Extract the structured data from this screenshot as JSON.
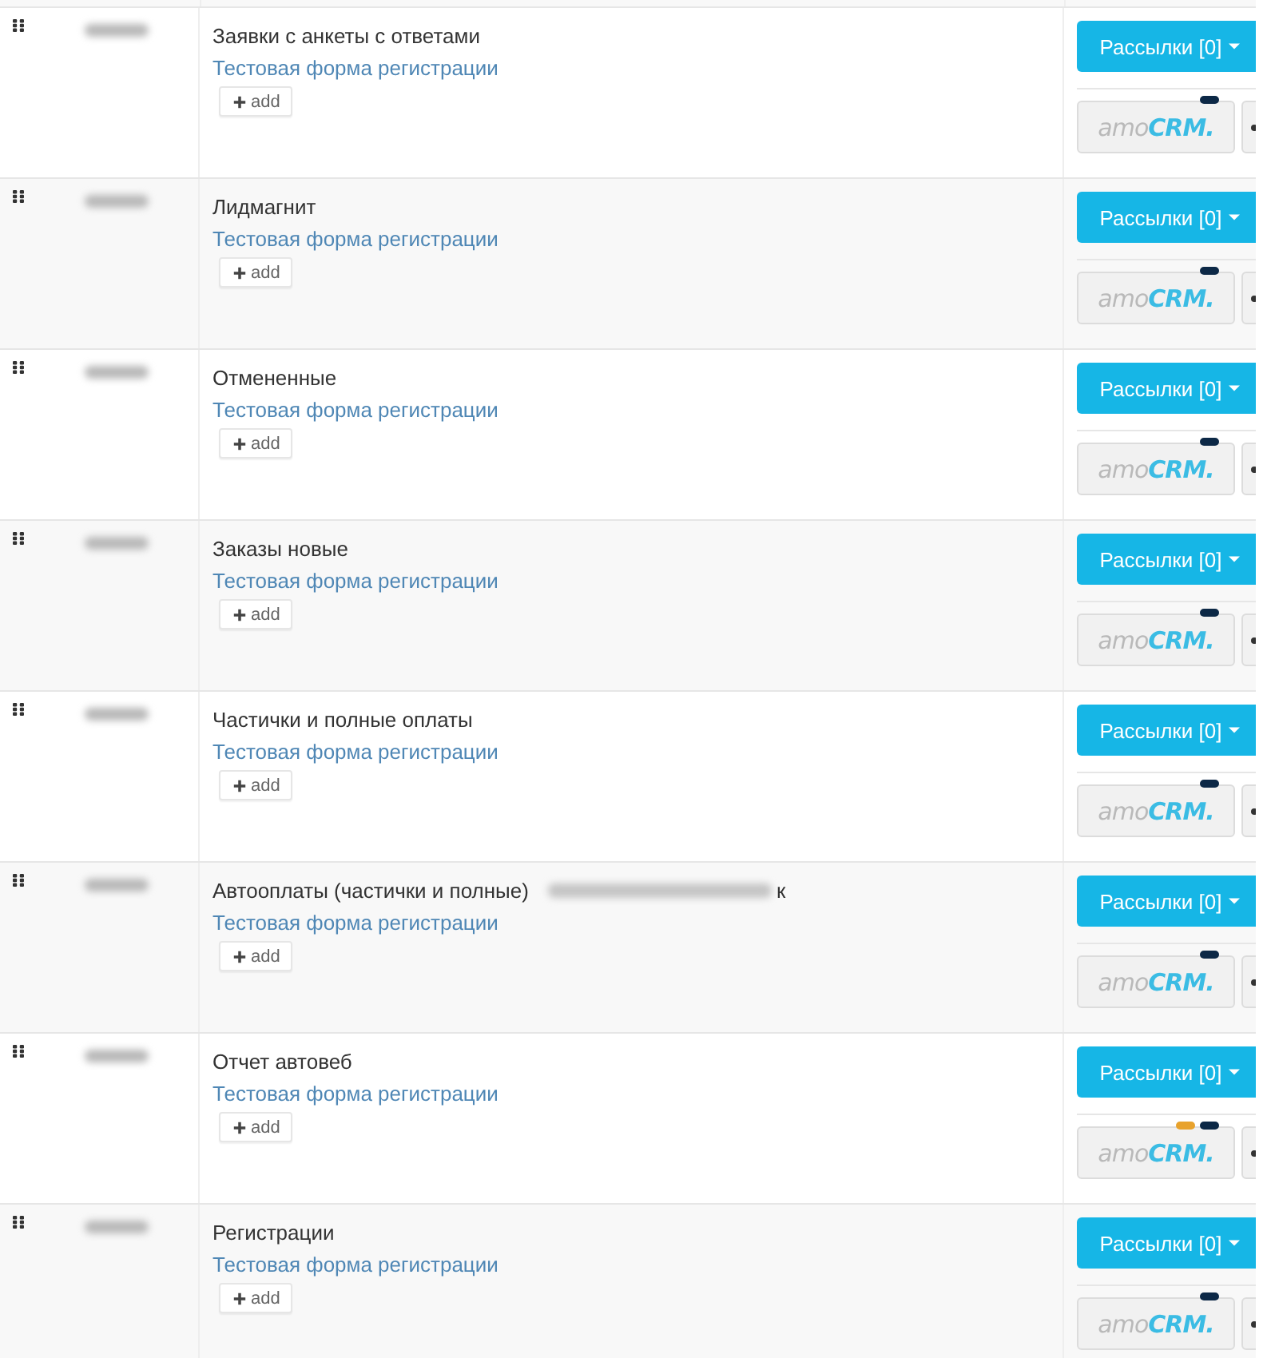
{
  "rows": [
    {
      "name": "Заявки с анкеты с ответами",
      "name_blurred": false,
      "form_link": "Тестовая форма регистрации",
      "add_label": "add",
      "mailings_label": "Рассылки [0]",
      "logo_prefix": "amo",
      "logo_suffix": "CRM.",
      "badges": [
        {
          "color": "#0c2846"
        }
      ]
    },
    {
      "name": "Лидмагнит",
      "name_blurred": false,
      "form_link": "Тестовая форма регистрации",
      "add_label": "add",
      "mailings_label": "Рассылки [0]",
      "logo_prefix": "amo",
      "logo_suffix": "CRM.",
      "badges": [
        {
          "color": "#0c2846"
        }
      ]
    },
    {
      "name": "Отмененные",
      "name_blurred": false,
      "form_link": "Тестовая форма регистрации",
      "add_label": "add",
      "mailings_label": "Рассылки [0]",
      "logo_prefix": "amo",
      "logo_suffix": "CRM.",
      "badges": [
        {
          "color": "#0c2846"
        }
      ]
    },
    {
      "name": "Заказы новые",
      "name_blurred": false,
      "form_link": "Тестовая форма регистрации",
      "add_label": "add",
      "mailings_label": "Рассылки [0]",
      "logo_prefix": "amo",
      "logo_suffix": "CRM.",
      "badges": [
        {
          "color": "#0c2846"
        }
      ]
    },
    {
      "name": "Частички и полные оплаты",
      "name_blurred": false,
      "form_link": "Тестовая форма регистрации",
      "add_label": "add",
      "mailings_label": "Рассылки [0]",
      "logo_prefix": "amo",
      "logo_suffix": "CRM.",
      "badges": [
        {
          "color": "#0c2846"
        }
      ]
    },
    {
      "name": "Автооплаты (частички и полные)",
      "name_blurred": true,
      "name_tail": "к",
      "form_link": "Тестовая форма регистрации",
      "add_label": "add",
      "mailings_label": "Рассылки [0]",
      "logo_prefix": "amo",
      "logo_suffix": "CRM.",
      "badges": [
        {
          "color": "#0c2846"
        }
      ]
    },
    {
      "name": "Отчет автовеб",
      "name_blurred": false,
      "form_link": "Тестовая форма регистрации",
      "add_label": "add",
      "mailings_label": "Рассылки [0]",
      "logo_prefix": "amo",
      "logo_suffix": "CRM.",
      "badges": [
        {
          "color": "#e8a22c"
        },
        {
          "color": "#0c2846"
        }
      ]
    },
    {
      "name": "Регистрации",
      "name_blurred": false,
      "form_link": "Тестовая форма регистрации",
      "add_label": "add",
      "mailings_label": "Рассылки [0]",
      "logo_prefix": "amo",
      "logo_suffix": "CRM.",
      "badges": [
        {
          "color": "#0c2846"
        }
      ]
    }
  ]
}
